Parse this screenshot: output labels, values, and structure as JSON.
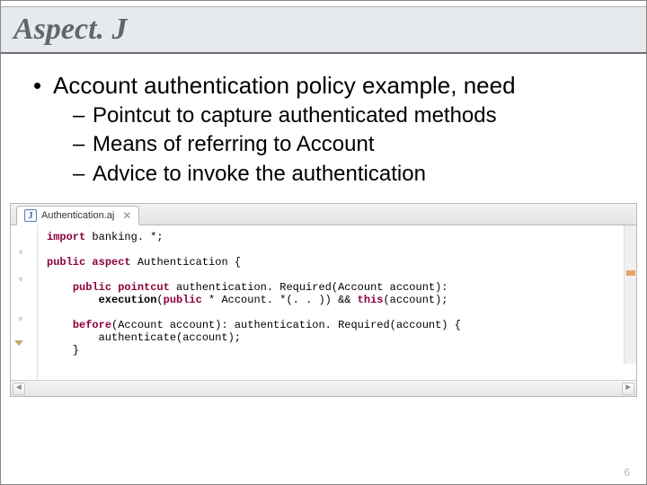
{
  "title": "Aspect. J",
  "bullet": "Account authentication policy example, need",
  "subs": [
    "Pointcut to capture authenticated methods",
    "Means of referring to Account",
    "Advice to invoke the authentication"
  ],
  "tab": {
    "icon_letter": "J",
    "label": "Authentication.aj",
    "close_glyph": "✕"
  },
  "code": {
    "l1_import": "import",
    "l1_rest": " banking. *;",
    "l3_vis": "public",
    "l3_aspect": " aspect",
    "l3_name": " Authentication {",
    "l5_indent": "    ",
    "l5_vis": "public",
    "l5_pc": " pointcut",
    "l5_rest": " authentication. Required(Account account):",
    "l6": "        execution(public * Account. *(. . )) && this(account);",
    "l6_exec": "execution",
    "l6_open": "(",
    "l6_pub": "public",
    "l6_mid": " * Account. *(. . )) && ",
    "l6_this": "this",
    "l6_end": "(account);",
    "l8_indent": "    ",
    "l8_before": "before",
    "l8_rest": "(Account account): authentication. Required(account) {",
    "l9": "        authenticate(account);",
    "l10": "    }"
  },
  "scroll": {
    "left_glyph": "◄",
    "right_glyph": "►"
  },
  "page_number": "6"
}
